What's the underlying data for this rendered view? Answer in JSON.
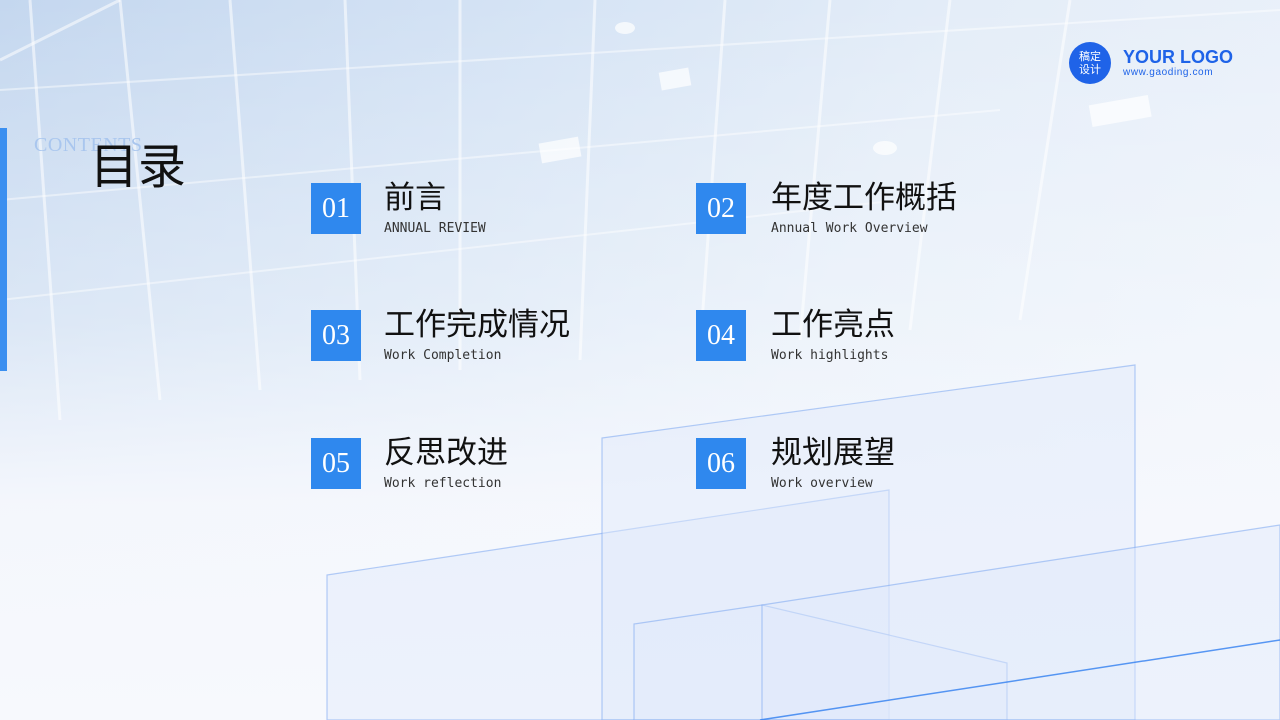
{
  "header": {
    "contents_label": "CONTENTS",
    "title": "目录"
  },
  "logo": {
    "badge_line1": "稿定",
    "badge_line2": "设计",
    "text": "YOUR LOGO",
    "url": "www.gaoding.com"
  },
  "items": [
    {
      "num": "01",
      "zh": "前言",
      "en": "ANNUAL REVIEW"
    },
    {
      "num": "02",
      "zh": "年度工作概括",
      "en": "Annual Work Overview"
    },
    {
      "num": "03",
      "zh": "工作完成情况",
      "en": "Work Completion"
    },
    {
      "num": "04",
      "zh": "工作亮点",
      "en": "Work highlights"
    },
    {
      "num": "05",
      "zh": "反思改进",
      "en": "Work reflection"
    },
    {
      "num": "06",
      "zh": "规划展望",
      "en": "Work overview"
    }
  ],
  "colors": {
    "accent": "#2f88ee",
    "logo_blue": "#1f63e8",
    "title_text": "#111111"
  }
}
